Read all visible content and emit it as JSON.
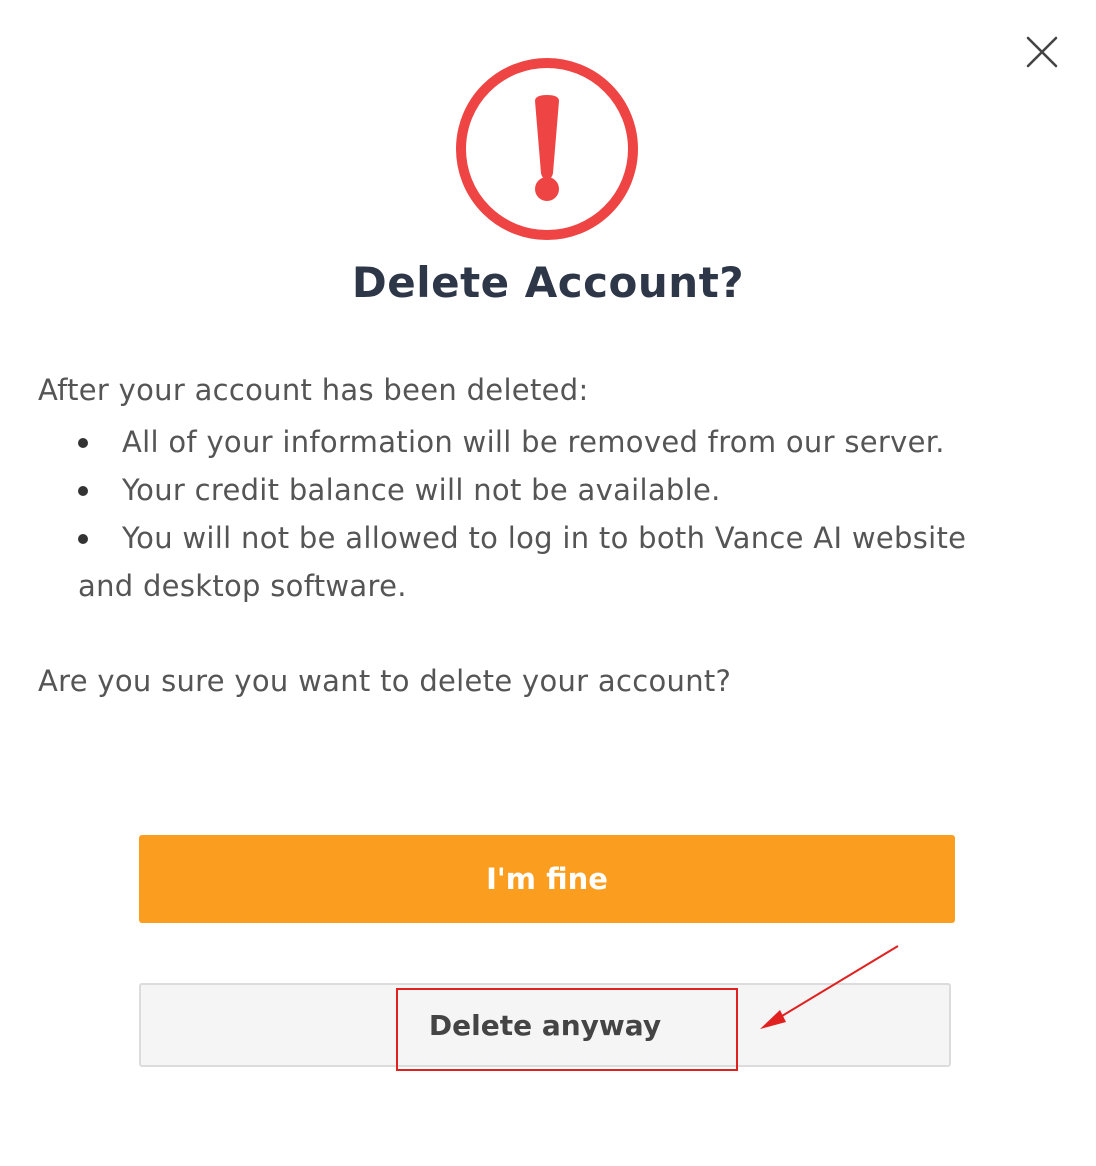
{
  "dialog": {
    "title": "Delete Account?",
    "intro": "After your account has been deleted:",
    "bullets": [
      "All of your information will be removed from our server.",
      "Your credit balance will not be available.",
      "You will not be allowed to log in to both Vance AI website",
      "and desktop software."
    ],
    "question": "Are you sure you want to delete your account?",
    "fine_button_label": "I'm fine",
    "delete_button_label": "Delete anyway"
  },
  "icons": {
    "close": "close-icon",
    "warning": "warning-icon"
  },
  "colors": {
    "warning_red": "#ef4444",
    "primary_orange": "#fb9e1f",
    "title_text": "#2d3748",
    "body_text": "#555555",
    "annotation_red": "#e0211f"
  }
}
